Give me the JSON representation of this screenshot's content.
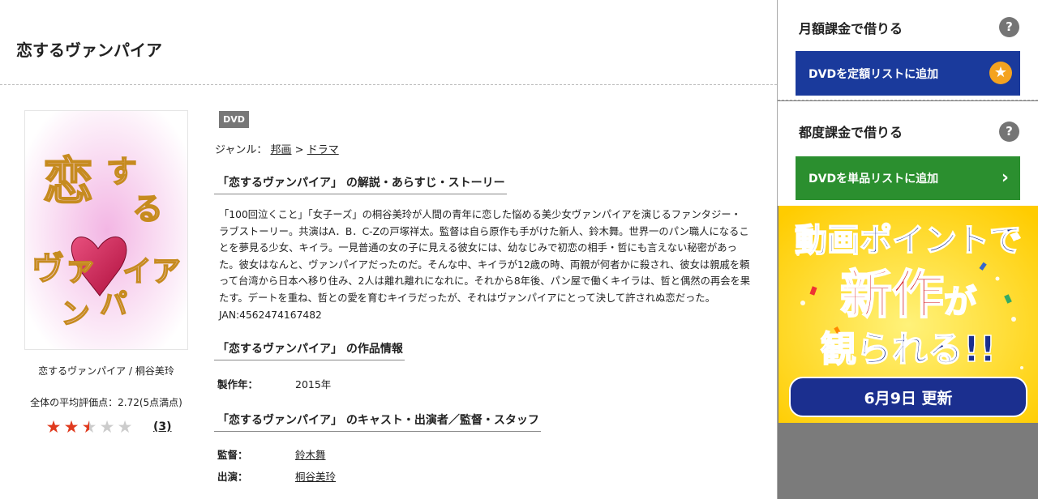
{
  "page": {
    "title": "恋するヴァンパイア"
  },
  "product": {
    "caption": "恋するヴァンパイア / 桐谷美玲",
    "jacket_text": "恋するヴァンパイア",
    "rating_text": "全体の平均評価点：2.72(5点満点)",
    "rating_value": 2.72,
    "rating_max": 5,
    "rating_count": "(3)",
    "star_glyph": "★"
  },
  "content": {
    "format": "DVD",
    "genre_label": "ジャンル：",
    "genre_parent": "邦画",
    "genre_sep": " > ",
    "genre_child": "ドラマ",
    "synopsis_heading": "「恋するヴァンパイア」 の解説・あらすじ・ストーリー",
    "synopsis": "「100回泣くこと」「女子ーズ」の桐谷美玲が人間の青年に恋した悩める美少女ヴァンパイアを演じるファンタジー・ラブストーリー。共演はA．B．C-Zの戸塚祥太。監督は自ら原作も手がけた新人、鈴木舞。世界一のパン職人になることを夢見る少女、キイラ。一見普通の女の子に見える彼女には、幼なじみで初恋の相手・哲にも言えない秘密があった。彼女はなんと、ヴァンパイアだったのだ。そんな中、キイラが12歳の時、両親が何者かに殺され、彼女は親戚を頼って台湾から日本へ移り住み、2人は離れ離れになれに。それから8年後、パン屋で働くキイラは、哲と偶然の再会を果たす。デートを重ね、哲との愛を育むキイラだったが、それはヴァンパイアにとって決して許されぬ恋だった。 JAN:4562474167482",
    "info_heading": "「恋するヴァンパイア」 の作品情報",
    "year_label": "製作年：",
    "year_value": "2015年",
    "cast_heading": "「恋するヴァンパイア」 のキャスト・出演者／監督・スタッフ",
    "director_label": "監督：",
    "director_value": "鈴木舞",
    "cast_label": "出演：",
    "cast_value": "桐谷美玲"
  },
  "sidebar": {
    "monthly_title": "月額課金で借りる",
    "monthly_button": "DVDを定額リストに追加",
    "single_title": "都度課金で借りる",
    "single_button": "DVDを単品リストに追加",
    "help_glyph": "?",
    "star_glyph": "★",
    "chevron_glyph": "›",
    "banner": {
      "line1": "動画ポイントで",
      "line2a": "新作",
      "line2b": "が",
      "line3": "観られる!!",
      "update": "6月9日 更新"
    }
  },
  "colors": {
    "accent_blue": "#1a3a9c",
    "accent_green": "#2b8f2f",
    "star_red": "#e03a1e",
    "banner_yellow": "#ffd60a"
  }
}
